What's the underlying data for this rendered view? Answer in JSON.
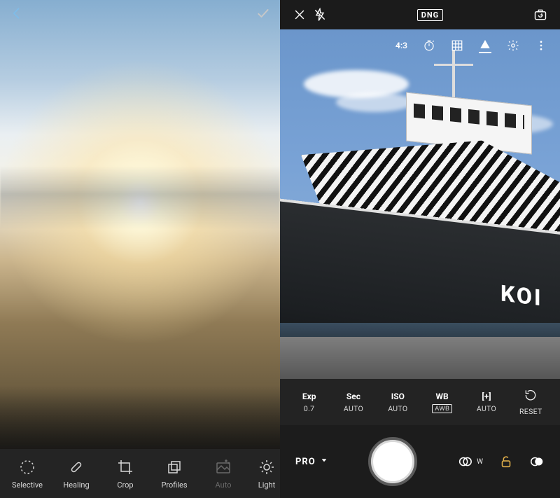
{
  "left": {
    "tools": [
      {
        "label": "Selective"
      },
      {
        "label": "Healing"
      },
      {
        "label": "Crop"
      },
      {
        "label": "Profiles"
      },
      {
        "label": "Auto"
      },
      {
        "label": "Light"
      }
    ]
  },
  "right": {
    "format_badge": "DNG",
    "aspect_ratio": "4:3",
    "hull_text": "KOI",
    "settings": {
      "exp": {
        "key": "Exp",
        "value": "0.7"
      },
      "sec": {
        "key": "Sec",
        "value": "AUTO"
      },
      "iso": {
        "key": "ISO",
        "value": "AUTO"
      },
      "wb": {
        "key": "WB",
        "value": "AWB"
      },
      "focus": {
        "key": "[+]",
        "value": "AUTO"
      },
      "reset": {
        "value": "RESET"
      }
    },
    "mode_label": "PRO",
    "wide_label": "W"
  }
}
